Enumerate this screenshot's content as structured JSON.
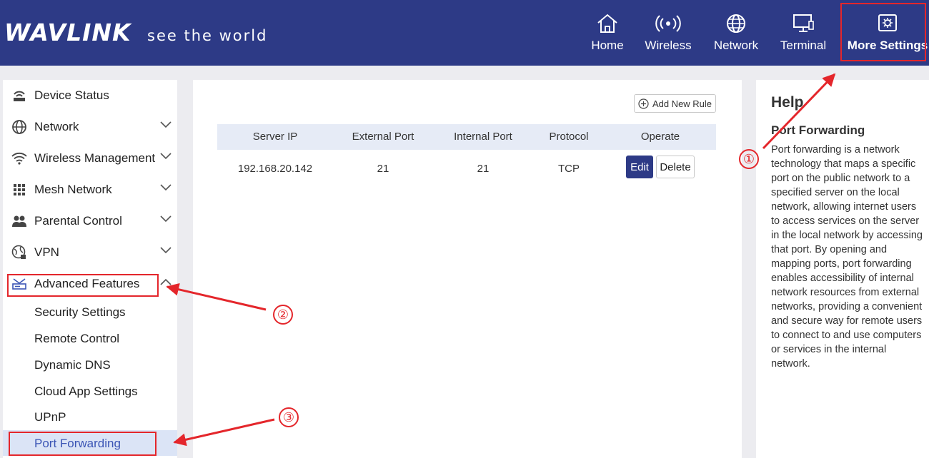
{
  "header": {
    "logo": "WAVLINK",
    "tagline": "see the world",
    "nav": [
      {
        "label": "Home",
        "icon": "home-icon"
      },
      {
        "label": "Wireless",
        "icon": "wireless-icon"
      },
      {
        "label": "Network",
        "icon": "globe-icon"
      },
      {
        "label": "Terminal",
        "icon": "monitor-icon"
      },
      {
        "label": "More Settings",
        "icon": "settings-icon"
      }
    ]
  },
  "sidebar": {
    "items": [
      {
        "label": "Device Status",
        "icon": "router-status-icon",
        "expandable": false
      },
      {
        "label": "Network",
        "icon": "globe-icon",
        "expandable": true
      },
      {
        "label": "Wireless Management",
        "icon": "wifi-icon",
        "expandable": true
      },
      {
        "label": "Mesh Network",
        "icon": "grid-dots-icon",
        "expandable": true
      },
      {
        "label": "Parental Control",
        "icon": "family-icon",
        "expandable": true
      },
      {
        "label": "VPN",
        "icon": "vpn-globe-icon",
        "expandable": true
      },
      {
        "label": "Advanced Features",
        "icon": "advanced-router-icon",
        "expandable": true,
        "expanded": true
      }
    ],
    "subitems": [
      {
        "label": "Security Settings"
      },
      {
        "label": "Remote Control"
      },
      {
        "label": "Dynamic DNS"
      },
      {
        "label": "Cloud App Settings"
      },
      {
        "label": "UPnP"
      },
      {
        "label": "Port Forwarding",
        "active": true
      }
    ]
  },
  "main": {
    "add_button": "Add New Rule",
    "columns": [
      "Server IP",
      "External Port",
      "Internal Port",
      "Protocol",
      "Operate"
    ],
    "rows": [
      {
        "server_ip": "192.168.20.142",
        "external_port": "21",
        "internal_port": "21",
        "protocol": "TCP"
      }
    ],
    "edit_label": "Edit",
    "delete_label": "Delete"
  },
  "help": {
    "title": "Help",
    "subtitle": "Port Forwarding",
    "text": "Port forwarding is a network technology that maps a specific port on the public network to a specified server on the local network, allowing internet users to access services on the server in the local network by accessing that port. By opening and mapping ports, port forwarding enables accessibility of internal network resources from external networks, providing a convenient and secure way for remote users to connect to and use computers or services in the internal network."
  },
  "annotations": {
    "step1": "①",
    "step2": "②",
    "step3": "③",
    "color": "#e4262b"
  }
}
